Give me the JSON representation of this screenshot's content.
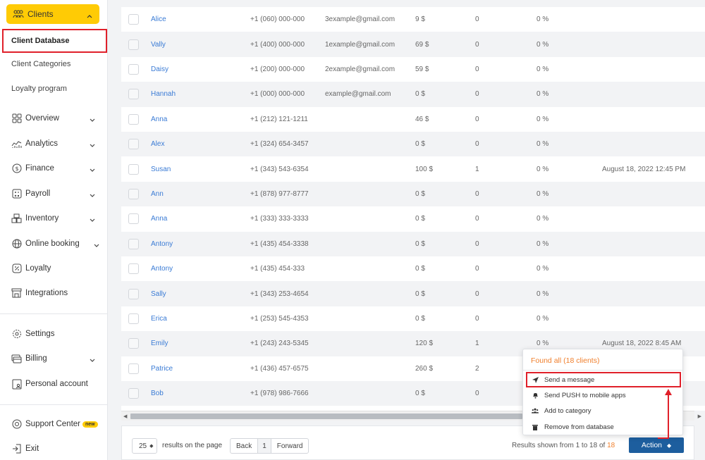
{
  "sidebar": {
    "clients": "Clients",
    "sub_items": [
      "Client Database",
      "Client Categories",
      "Loyalty program"
    ],
    "nav": [
      {
        "label": "Overview",
        "icon": "grid-icon",
        "chevron": true
      },
      {
        "label": "Analytics",
        "icon": "chart-icon",
        "chevron": true
      },
      {
        "label": "Finance",
        "icon": "dollar-icon",
        "chevron": true
      },
      {
        "label": "Payroll",
        "icon": "calculator-icon",
        "chevron": true
      },
      {
        "label": "Inventory",
        "icon": "boxes-icon",
        "chevron": true
      },
      {
        "label": "Online booking",
        "icon": "globe-icon",
        "chevron": true
      },
      {
        "label": "Loyalty",
        "icon": "percent-icon",
        "chevron": false
      },
      {
        "label": "Integrations",
        "icon": "store-icon",
        "chevron": false
      }
    ],
    "bottom": [
      {
        "label": "Settings",
        "icon": "gear-icon",
        "chevron": false
      },
      {
        "label": "Billing",
        "icon": "card-icon",
        "chevron": true
      },
      {
        "label": "Personal account",
        "icon": "account-icon",
        "chevron": false
      }
    ],
    "support": "Support Center",
    "support_badge": "new",
    "exit": "Exit"
  },
  "table": {
    "rows": [
      {
        "name": "Alice",
        "phone": "+1 (060) 000-000",
        "email": "3example@gmail.com",
        "paid": "9 $",
        "visits": "0",
        "discount": "0 %",
        "last": ""
      },
      {
        "name": "Vally",
        "phone": "+1 (400) 000-000",
        "email": "1example@gmail.com",
        "paid": "69 $",
        "visits": "0",
        "discount": "0 %",
        "last": ""
      },
      {
        "name": "Daisy",
        "phone": "+1 (200) 000-000",
        "email": "2example@gmail.com",
        "paid": "59 $",
        "visits": "0",
        "discount": "0 %",
        "last": ""
      },
      {
        "name": "Hannah",
        "phone": "+1 (000) 000-000",
        "email": "example@gmail.com",
        "paid": "0 $",
        "visits": "0",
        "discount": "0 %",
        "last": ""
      },
      {
        "name": "Anna",
        "phone": "+1 (212) 121-1211",
        "email": "",
        "paid": "46 $",
        "visits": "0",
        "discount": "0 %",
        "last": ""
      },
      {
        "name": "Alex",
        "phone": "+1 (324) 654-3457",
        "email": "",
        "paid": "0 $",
        "visits": "0",
        "discount": "0 %",
        "last": ""
      },
      {
        "name": "Susan",
        "phone": "+1 (343) 543-6354",
        "email": "",
        "paid": "100 $",
        "visits": "1",
        "discount": "0 %",
        "last": "August 18, 2022 12:45 PM"
      },
      {
        "name": "Ann",
        "phone": "+1 (878) 977-8777",
        "email": "",
        "paid": "0 $",
        "visits": "0",
        "discount": "0 %",
        "last": ""
      },
      {
        "name": "Anna",
        "phone": "+1 (333) 333-3333",
        "email": "",
        "paid": "0 $",
        "visits": "0",
        "discount": "0 %",
        "last": ""
      },
      {
        "name": "Antony",
        "phone": "+1 (435) 454-3338",
        "email": "",
        "paid": "0 $",
        "visits": "0",
        "discount": "0 %",
        "last": ""
      },
      {
        "name": "Antony",
        "phone": "+1 (435) 454-333",
        "email": "",
        "paid": "0 $",
        "visits": "0",
        "discount": "0 %",
        "last": ""
      },
      {
        "name": "Sally",
        "phone": "+1 (343) 253-4654",
        "email": "",
        "paid": "0 $",
        "visits": "0",
        "discount": "0 %",
        "last": ""
      },
      {
        "name": "Erica",
        "phone": "+1 (253) 545-4353",
        "email": "",
        "paid": "0 $",
        "visits": "0",
        "discount": "0 %",
        "last": ""
      },
      {
        "name": "Emily",
        "phone": "+1 (243) 243-5345",
        "email": "",
        "paid": "120 $",
        "visits": "1",
        "discount": "0 %",
        "last": "August 18, 2022 8:45 AM"
      },
      {
        "name": "Patrice",
        "phone": "+1 (436) 457-6575",
        "email": "",
        "paid": "260 $",
        "visits": "2",
        "discount": "",
        "last": ""
      },
      {
        "name": "Bob",
        "phone": "+1 (978) 986-7666",
        "email": "",
        "paid": "0 $",
        "visits": "0",
        "discount": "",
        "last": ""
      }
    ]
  },
  "footer": {
    "per_page": "25",
    "per_page_label": "results on the page",
    "back": "Back",
    "page": "1",
    "forward": "Forward",
    "results_prefix": "Results shown from 1 to 18 of ",
    "results_total": "18",
    "action": "Action"
  },
  "dropdown": {
    "header": "Found all (18 clients)",
    "items": [
      {
        "label": "Send a message",
        "icon": "send-icon"
      },
      {
        "label": "Send PUSH to mobile apps",
        "icon": "bell-icon"
      },
      {
        "label": "Add to category",
        "icon": "users-icon"
      },
      {
        "label": "Remove from database",
        "icon": "trash-icon"
      }
    ]
  },
  "colors": {
    "accent_yellow": "#ffcb05",
    "link_blue": "#3a7bd5",
    "action_blue": "#1d5e9e",
    "orange": "#f07f2c",
    "annotation_red": "#e0202a"
  }
}
